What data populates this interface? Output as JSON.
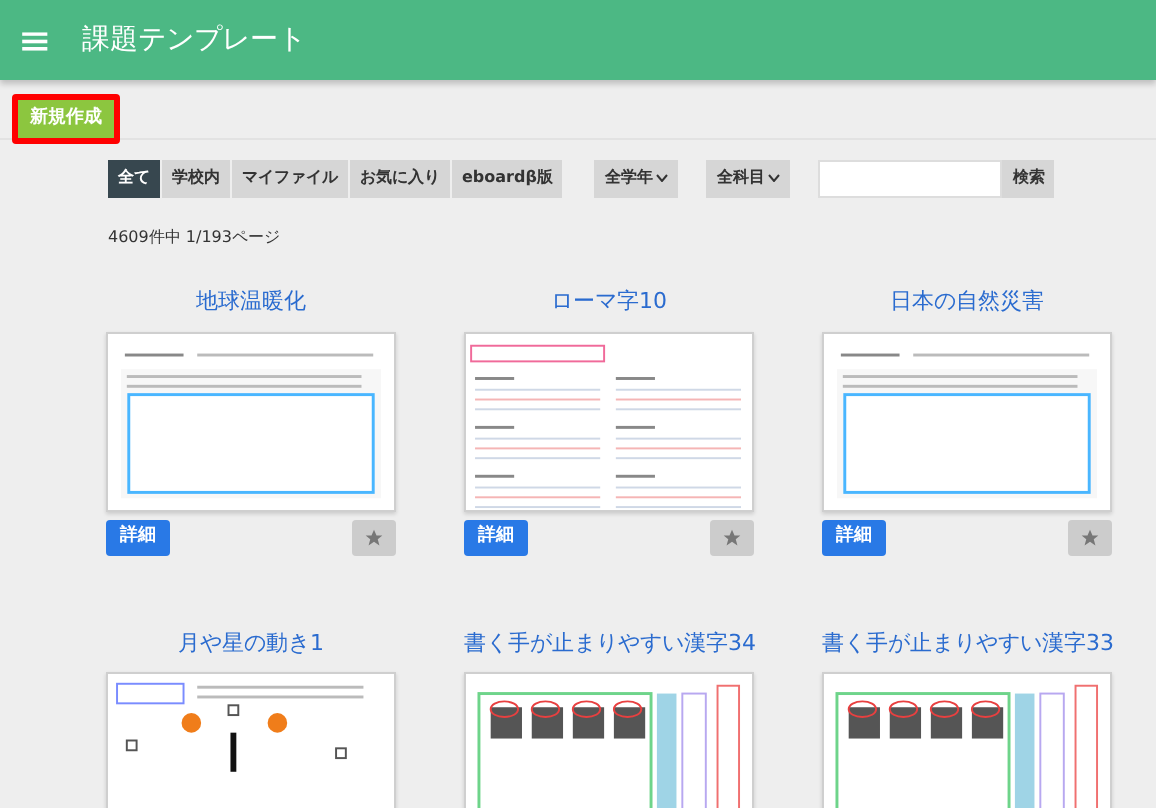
{
  "header": {
    "menu_icon": "≡",
    "title": "課題テンプレート"
  },
  "new_button": "新規作成",
  "filters": [
    {
      "label": "全て",
      "selected": true
    },
    {
      "label": "学校内",
      "selected": false
    },
    {
      "label": "マイファイル",
      "selected": false
    },
    {
      "label": "お気に入り",
      "selected": false
    },
    {
      "label": "eboardβ版",
      "selected": false
    }
  ],
  "dropdowns": [
    "全学年",
    "全科目"
  ],
  "search": {
    "button": "検索"
  },
  "result_count": "4609件中 1/193ページ",
  "templates": [
    {
      "title": "地球温暖化",
      "kind": "essay",
      "detail": "詳細",
      "favorited": false
    },
    {
      "title": "ローマ字10",
      "kind": "lines",
      "detail": "詳細",
      "favorited": false
    },
    {
      "title": "日本の自然災害",
      "kind": "essay",
      "detail": "詳細",
      "favorited": false
    },
    {
      "title": "月や星の動き1",
      "kind": "astronomy"
    },
    {
      "title": "書く手が止まりやすい漢字34",
      "kind": "kanji"
    },
    {
      "title": "書く手が止まりやすい漢字33",
      "kind": "kanji"
    }
  ]
}
